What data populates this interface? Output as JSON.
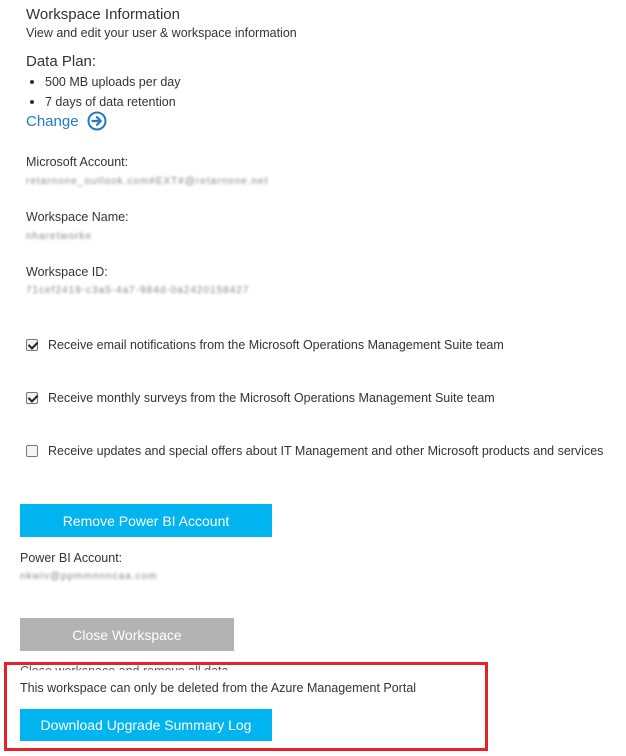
{
  "header": {
    "title": "Workspace Information",
    "subtitle": "View and edit your user & workspace information"
  },
  "data_plan": {
    "heading": "Data Plan:",
    "items": [
      "500 MB uploads per day",
      "7 days of data retention"
    ],
    "change_label": "Change",
    "change_icon": "arrow-right-circle-icon",
    "accent": "#1e7bc4"
  },
  "account": {
    "microsoft_label": "Microsoft Account:",
    "microsoft_value": "retarnone_outlook.com#EXT#@retarnone.net",
    "workspace_name_label": "Workspace Name:",
    "workspace_name_value": "nharetworke",
    "workspace_id_label": "Workspace ID:",
    "workspace_id_value": "71cef2419-c3a5-4a7-984d-0a2420158427"
  },
  "preferences": [
    {
      "label": "Receive email notifications from the Microsoft Operations Management Suite team",
      "checked": true
    },
    {
      "label": "Receive monthly surveys from the Microsoft Operations Management Suite team",
      "checked": true
    },
    {
      "label": "Receive updates and special offers about IT Management and other Microsoft products and services",
      "checked": false
    }
  ],
  "power_bi": {
    "remove_button": "Remove Power BI Account",
    "account_label": "Power BI Account:",
    "account_value": "nkwiv@ppmmnnncaa.com"
  },
  "close": {
    "button": "Close Workspace",
    "description": "Close workspace and remove all data",
    "note": "This workspace can only be deleted from the Azure Management Portal",
    "download_button": "Download Upgrade Summary Log"
  },
  "colors": {
    "button_blue": "#00b4f0",
    "button_gray": "#b3b3b3",
    "highlight_red": "#e3232c"
  }
}
